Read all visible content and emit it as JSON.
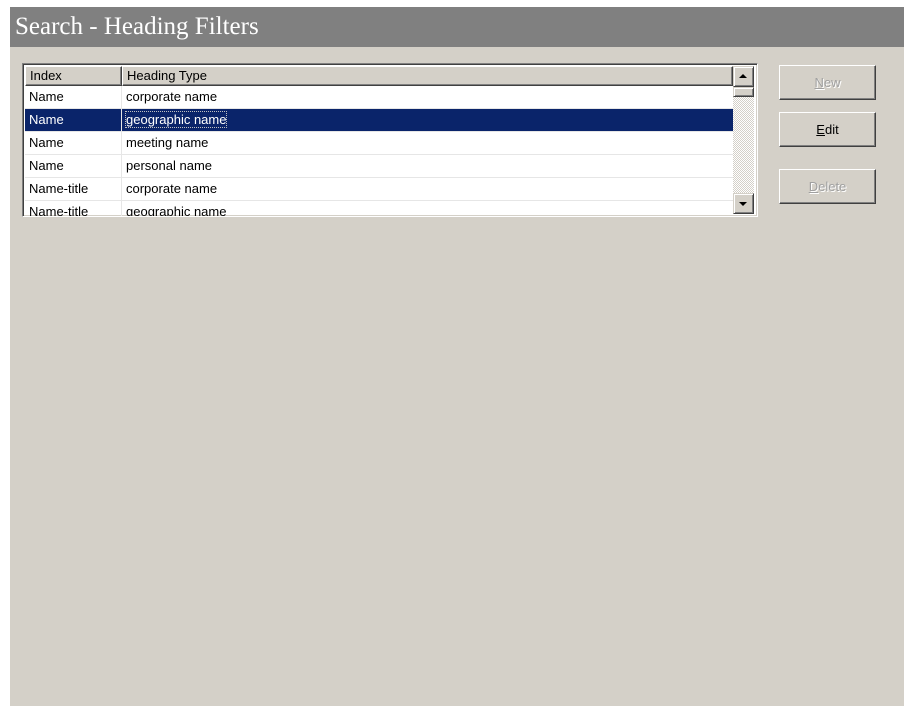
{
  "title": "Search - Heading Filters",
  "list": {
    "columns": [
      "Index",
      "Heading Type"
    ],
    "selected_row": 1,
    "rows": [
      {
        "index": "Name",
        "heading_type": "corporate name"
      },
      {
        "index": "Name",
        "heading_type": "geographic name"
      },
      {
        "index": "Name",
        "heading_type": "meeting name"
      },
      {
        "index": "Name",
        "heading_type": "personal name"
      },
      {
        "index": "Name-title",
        "heading_type": "corporate name"
      },
      {
        "index": "Name-title",
        "heading_type": "geographic name"
      }
    ]
  },
  "buttons": {
    "new": {
      "mnemonic": "N",
      "rest": "ew",
      "enabled": false
    },
    "edit": {
      "mnemonic": "E",
      "rest": "dit",
      "enabled": true
    },
    "delete": {
      "mnemonic": "D",
      "rest": "elete",
      "enabled": false
    }
  },
  "icons": {
    "scroll_up": "arrow-up-icon",
    "scroll_down": "arrow-down-icon"
  },
  "colors": {
    "panel": "#d4d0c8",
    "title_bar": "#808080",
    "selection": "#0a246a"
  }
}
